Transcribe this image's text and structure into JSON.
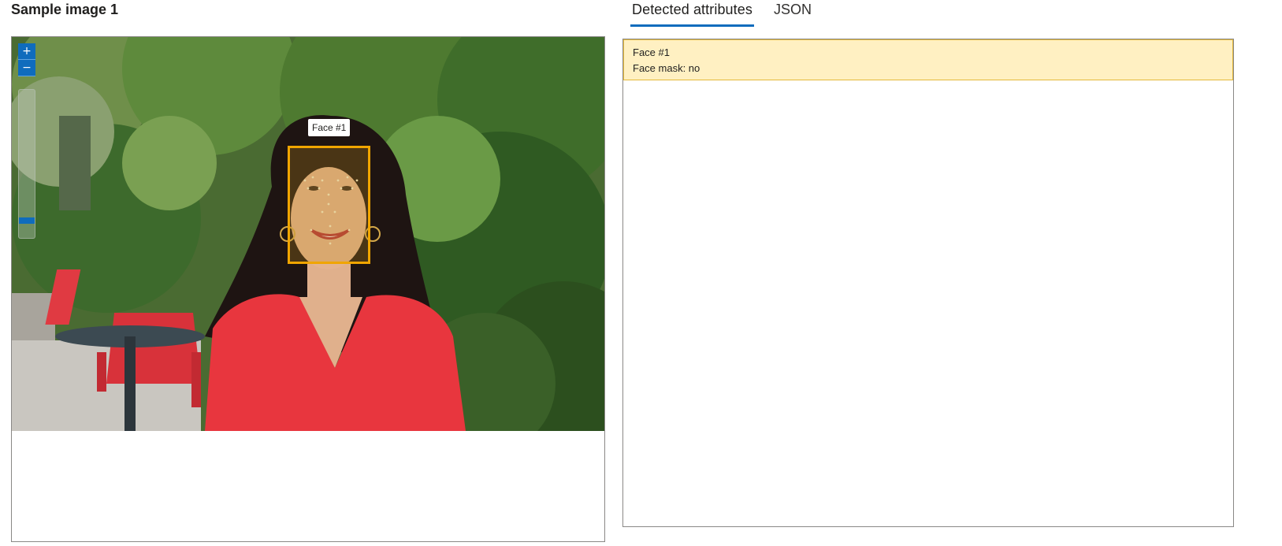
{
  "title": "Sample image 1",
  "tabs": [
    {
      "label": "Detected attributes",
      "active": true
    },
    {
      "label": "JSON",
      "active": false
    }
  ],
  "zoom": {
    "in_icon": "plus-icon",
    "out_icon": "minus-icon",
    "in_symbol": "+",
    "out_symbol": "−"
  },
  "image": {
    "face_label": "Face #1"
  },
  "results": [
    {
      "name": "Face #1",
      "attribute": "Face mask: no"
    }
  ],
  "colors": {
    "accent": "#0f6cbd",
    "face_box": "#f0a500",
    "card_bg": "#fff0c2",
    "card_border": "#e3b83a"
  }
}
